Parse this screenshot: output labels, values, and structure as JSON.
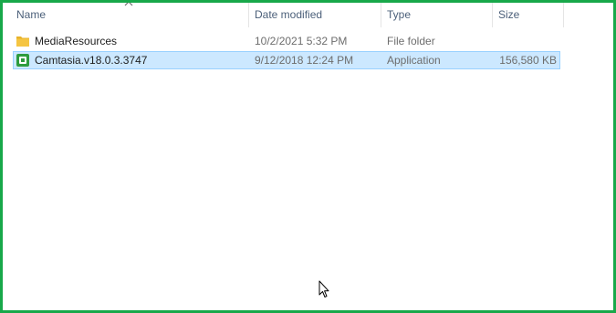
{
  "columns": {
    "name": "Name",
    "date_modified": "Date modified",
    "type": "Type",
    "size": "Size"
  },
  "files": [
    {
      "name": "MediaResources",
      "date_modified": "10/2/2021 5:32 PM",
      "type": "File folder",
      "size": "",
      "icon": "folder-icon",
      "selected": false
    },
    {
      "name": "Camtasia.v18.0.3.3747",
      "date_modified": "9/12/2018 12:24 PM",
      "type": "Application",
      "size": "156,580 KB",
      "icon": "camtasia-app-icon",
      "selected": true
    }
  ],
  "colors": {
    "frame_border": "#18a84a",
    "selection_bg": "#cce8ff",
    "selection_border": "#99d1ff",
    "header_text": "#4c607a",
    "folder_yellow": "#f5c542",
    "app_green": "#2e9c3e"
  }
}
